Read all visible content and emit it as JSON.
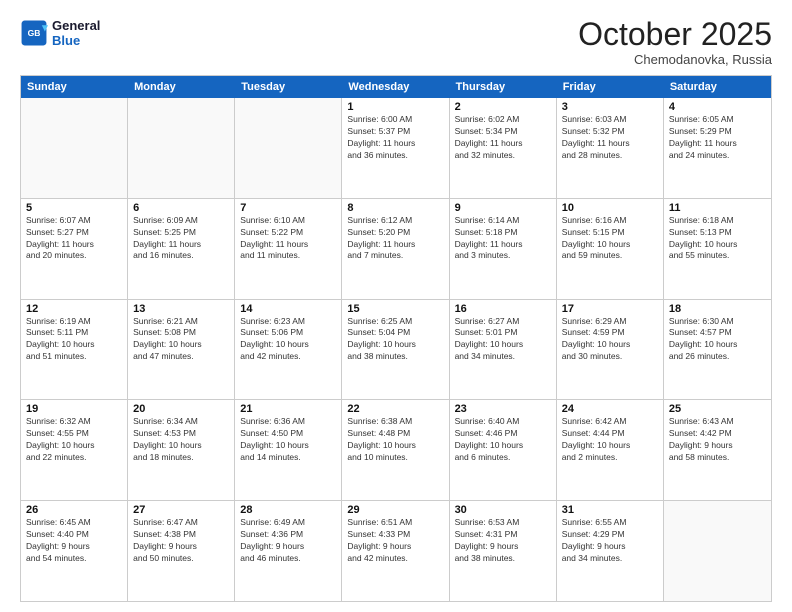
{
  "header": {
    "logo_line1": "General",
    "logo_line2": "Blue",
    "month": "October 2025",
    "location": "Chemodanovka, Russia"
  },
  "day_headers": [
    "Sunday",
    "Monday",
    "Tuesday",
    "Wednesday",
    "Thursday",
    "Friday",
    "Saturday"
  ],
  "weeks": [
    [
      {
        "num": "",
        "info": ""
      },
      {
        "num": "",
        "info": ""
      },
      {
        "num": "",
        "info": ""
      },
      {
        "num": "1",
        "info": "Sunrise: 6:00 AM\nSunset: 5:37 PM\nDaylight: 11 hours\nand 36 minutes."
      },
      {
        "num": "2",
        "info": "Sunrise: 6:02 AM\nSunset: 5:34 PM\nDaylight: 11 hours\nand 32 minutes."
      },
      {
        "num": "3",
        "info": "Sunrise: 6:03 AM\nSunset: 5:32 PM\nDaylight: 11 hours\nand 28 minutes."
      },
      {
        "num": "4",
        "info": "Sunrise: 6:05 AM\nSunset: 5:29 PM\nDaylight: 11 hours\nand 24 minutes."
      }
    ],
    [
      {
        "num": "5",
        "info": "Sunrise: 6:07 AM\nSunset: 5:27 PM\nDaylight: 11 hours\nand 20 minutes."
      },
      {
        "num": "6",
        "info": "Sunrise: 6:09 AM\nSunset: 5:25 PM\nDaylight: 11 hours\nand 16 minutes."
      },
      {
        "num": "7",
        "info": "Sunrise: 6:10 AM\nSunset: 5:22 PM\nDaylight: 11 hours\nand 11 minutes."
      },
      {
        "num": "8",
        "info": "Sunrise: 6:12 AM\nSunset: 5:20 PM\nDaylight: 11 hours\nand 7 minutes."
      },
      {
        "num": "9",
        "info": "Sunrise: 6:14 AM\nSunset: 5:18 PM\nDaylight: 11 hours\nand 3 minutes."
      },
      {
        "num": "10",
        "info": "Sunrise: 6:16 AM\nSunset: 5:15 PM\nDaylight: 10 hours\nand 59 minutes."
      },
      {
        "num": "11",
        "info": "Sunrise: 6:18 AM\nSunset: 5:13 PM\nDaylight: 10 hours\nand 55 minutes."
      }
    ],
    [
      {
        "num": "12",
        "info": "Sunrise: 6:19 AM\nSunset: 5:11 PM\nDaylight: 10 hours\nand 51 minutes."
      },
      {
        "num": "13",
        "info": "Sunrise: 6:21 AM\nSunset: 5:08 PM\nDaylight: 10 hours\nand 47 minutes."
      },
      {
        "num": "14",
        "info": "Sunrise: 6:23 AM\nSunset: 5:06 PM\nDaylight: 10 hours\nand 42 minutes."
      },
      {
        "num": "15",
        "info": "Sunrise: 6:25 AM\nSunset: 5:04 PM\nDaylight: 10 hours\nand 38 minutes."
      },
      {
        "num": "16",
        "info": "Sunrise: 6:27 AM\nSunset: 5:01 PM\nDaylight: 10 hours\nand 34 minutes."
      },
      {
        "num": "17",
        "info": "Sunrise: 6:29 AM\nSunset: 4:59 PM\nDaylight: 10 hours\nand 30 minutes."
      },
      {
        "num": "18",
        "info": "Sunrise: 6:30 AM\nSunset: 4:57 PM\nDaylight: 10 hours\nand 26 minutes."
      }
    ],
    [
      {
        "num": "19",
        "info": "Sunrise: 6:32 AM\nSunset: 4:55 PM\nDaylight: 10 hours\nand 22 minutes."
      },
      {
        "num": "20",
        "info": "Sunrise: 6:34 AM\nSunset: 4:53 PM\nDaylight: 10 hours\nand 18 minutes."
      },
      {
        "num": "21",
        "info": "Sunrise: 6:36 AM\nSunset: 4:50 PM\nDaylight: 10 hours\nand 14 minutes."
      },
      {
        "num": "22",
        "info": "Sunrise: 6:38 AM\nSunset: 4:48 PM\nDaylight: 10 hours\nand 10 minutes."
      },
      {
        "num": "23",
        "info": "Sunrise: 6:40 AM\nSunset: 4:46 PM\nDaylight: 10 hours\nand 6 minutes."
      },
      {
        "num": "24",
        "info": "Sunrise: 6:42 AM\nSunset: 4:44 PM\nDaylight: 10 hours\nand 2 minutes."
      },
      {
        "num": "25",
        "info": "Sunrise: 6:43 AM\nSunset: 4:42 PM\nDaylight: 9 hours\nand 58 minutes."
      }
    ],
    [
      {
        "num": "26",
        "info": "Sunrise: 6:45 AM\nSunset: 4:40 PM\nDaylight: 9 hours\nand 54 minutes."
      },
      {
        "num": "27",
        "info": "Sunrise: 6:47 AM\nSunset: 4:38 PM\nDaylight: 9 hours\nand 50 minutes."
      },
      {
        "num": "28",
        "info": "Sunrise: 6:49 AM\nSunset: 4:36 PM\nDaylight: 9 hours\nand 46 minutes."
      },
      {
        "num": "29",
        "info": "Sunrise: 6:51 AM\nSunset: 4:33 PM\nDaylight: 9 hours\nand 42 minutes."
      },
      {
        "num": "30",
        "info": "Sunrise: 6:53 AM\nSunset: 4:31 PM\nDaylight: 9 hours\nand 38 minutes."
      },
      {
        "num": "31",
        "info": "Sunrise: 6:55 AM\nSunset: 4:29 PM\nDaylight: 9 hours\nand 34 minutes."
      },
      {
        "num": "",
        "info": ""
      }
    ]
  ]
}
